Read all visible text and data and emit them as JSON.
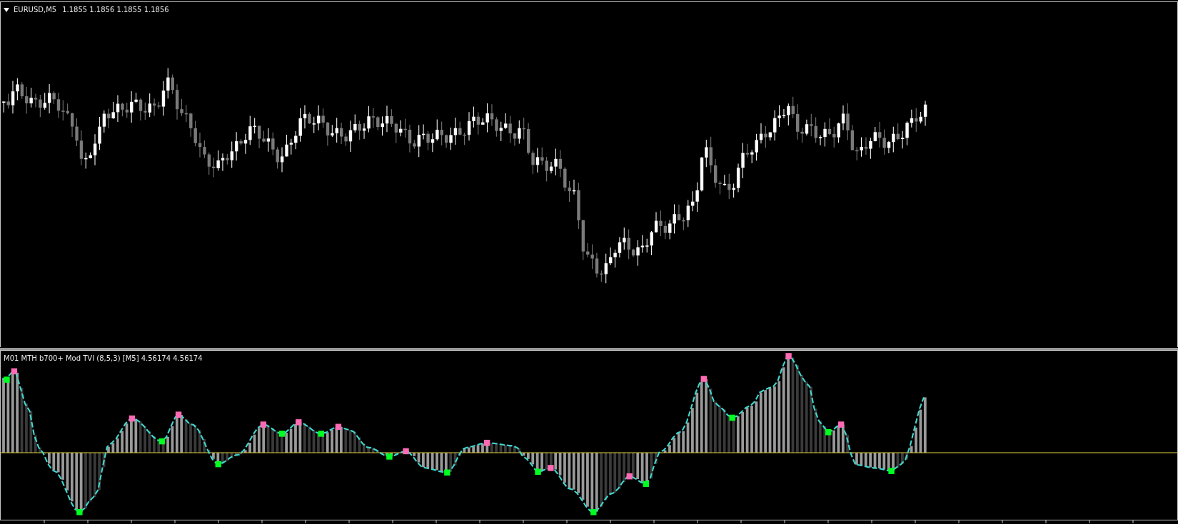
{
  "main_chart": {
    "symbol": "EURUSD,M5",
    "prices": "1.1855 1.1856 1.1855 1.1856"
  },
  "indicator": {
    "label": "M01 MTH b700+ Mod TVI (8,5,3) [M5] 4.56174 4.56174"
  }
}
